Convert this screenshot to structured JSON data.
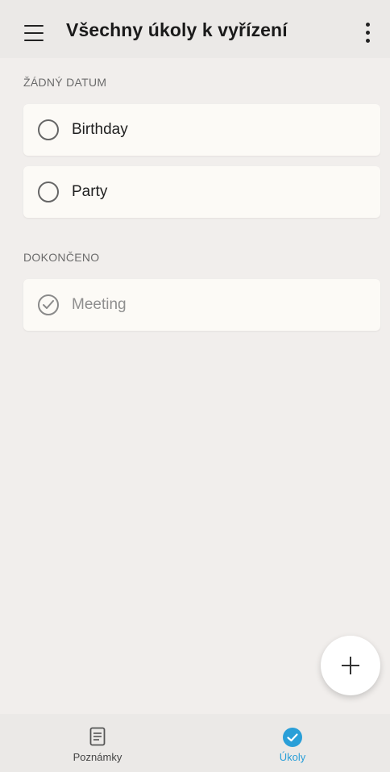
{
  "header": {
    "title": "Všechny úkoly k vyřízení",
    "menu_icon": "hamburger-menu-icon",
    "more_icon": "more-vertical-icon"
  },
  "sections": [
    {
      "title": "ŽÁDNÝ DATUM",
      "tasks": [
        {
          "text": "Birthday",
          "completed": false
        },
        {
          "text": "Party",
          "completed": false
        }
      ]
    },
    {
      "title": "DOKONČENO",
      "tasks": [
        {
          "text": "Meeting",
          "completed": true
        }
      ]
    }
  ],
  "fab": {
    "icon": "plus-icon"
  },
  "bottom_nav": {
    "items": [
      {
        "label": "Poznámky",
        "icon": "notes-icon",
        "active": false
      },
      {
        "label": "Úkoly",
        "icon": "tasks-check-icon",
        "active": true
      }
    ]
  },
  "colors": {
    "background": "#f1eeec",
    "bar": "#ebe9e7",
    "card": "#fcfaf6",
    "accent": "#2a9fd8"
  }
}
